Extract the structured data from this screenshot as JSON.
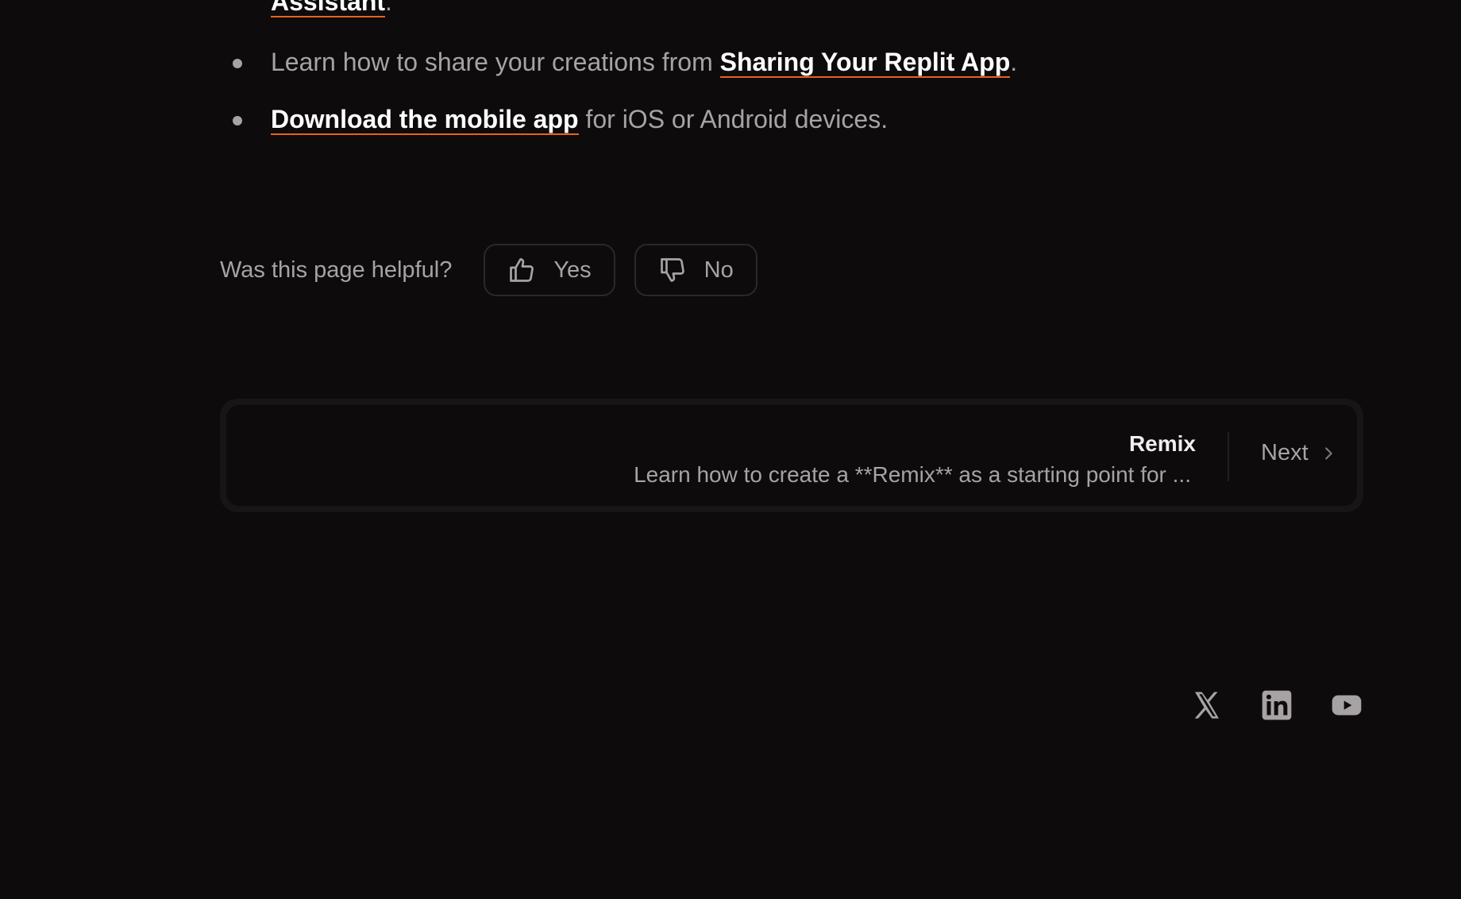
{
  "content": {
    "partial_line": {
      "link": "Assistant",
      "suffix": "."
    },
    "bullets": [
      {
        "prefix": "Learn how to share your creations from ",
        "link": "Sharing Your Replit App",
        "suffix": "."
      },
      {
        "prefix": "",
        "link": "Download the mobile app",
        "suffix": " for iOS or Android devices."
      }
    ]
  },
  "feedback": {
    "question": "Was this page helpful?",
    "yes_label": "Yes",
    "no_label": "No"
  },
  "pagination": {
    "next_title": "Remix",
    "next_description": "Learn how to create a **Remix** as a starting point for ...",
    "next_label": "Next"
  },
  "footer": {
    "socials": [
      {
        "name": "x-icon"
      },
      {
        "name": "linkedin-icon"
      },
      {
        "name": "youtube-icon"
      }
    ]
  },
  "colors": {
    "background": "#0e0b0c",
    "link_underline": "#e8621b",
    "text_muted": "#a7a3a5",
    "text_strong": "#ffffff"
  }
}
